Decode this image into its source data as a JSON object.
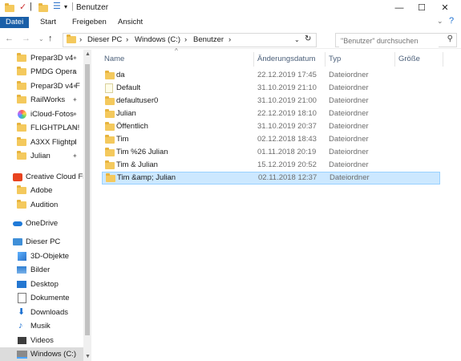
{
  "window": {
    "title": "Benutzer",
    "controls": {
      "minimize": "—",
      "maximize": "☐",
      "close": "✕"
    }
  },
  "ribbon": {
    "tabs": [
      {
        "label": "Datei",
        "active": true
      },
      {
        "label": "Start"
      },
      {
        "label": "Freigeben"
      },
      {
        "label": "Ansicht"
      }
    ]
  },
  "address": {
    "breadcrumbs": [
      "Dieser PC",
      "Windows (C:)",
      "Benutzer"
    ],
    "separator": "›"
  },
  "search": {
    "placeholder": "\"Benutzer\" durchsuchen"
  },
  "sidebar": {
    "items": [
      {
        "label": "Prepar3D v4",
        "icon": "folder-icon",
        "pinned": true
      },
      {
        "label": "PMDG Opera",
        "icon": "folder-icon",
        "pinned": true
      },
      {
        "label": "Prepar3D v4 F",
        "icon": "folder-icon",
        "pinned": true
      },
      {
        "label": "RailWorks",
        "icon": "folder-icon",
        "pinned": true
      },
      {
        "label": "iCloud-Fotos",
        "icon": "icloud-icon",
        "pinned": true
      },
      {
        "label": "FLIGHTPLAN!",
        "icon": "folder-icon",
        "pinned": true
      },
      {
        "label": "A3XX Flightpl",
        "icon": "folder-icon",
        "pinned": true
      },
      {
        "label": "Julian",
        "icon": "folder-icon",
        "pinned": true
      },
      {
        "label": "Creative Cloud Fil",
        "icon": "creative-cloud-icon"
      },
      {
        "label": "Adobe",
        "icon": "folder-icon"
      },
      {
        "label": "Audition",
        "icon": "folder-icon"
      },
      {
        "label": "OneDrive",
        "icon": "onedrive-icon"
      },
      {
        "label": "Dieser PC",
        "icon": "pc-icon"
      },
      {
        "label": "3D-Objekte",
        "icon": "3d-objects-icon"
      },
      {
        "label": "Bilder",
        "icon": "pictures-icon"
      },
      {
        "label": "Desktop",
        "icon": "desktop-icon"
      },
      {
        "label": "Dokumente",
        "icon": "documents-icon"
      },
      {
        "label": "Downloads",
        "icon": "downloads-icon"
      },
      {
        "label": "Musik",
        "icon": "music-icon"
      },
      {
        "label": "Videos",
        "icon": "videos-icon"
      },
      {
        "label": "Windows (C:)",
        "icon": "drive-icon",
        "selected": true
      }
    ]
  },
  "table": {
    "columns": [
      "Name",
      "Änderungsdatum",
      "Typ",
      "Größe"
    ],
    "rows": [
      {
        "name": "da",
        "date": "22.12.2019 17:45",
        "type": "Dateiordner"
      },
      {
        "name": "Default",
        "date": "31.10.2019 21:10",
        "type": "Dateiordner"
      },
      {
        "name": "defaultuser0",
        "date": "31.10.2019 21:00",
        "type": "Dateiordner"
      },
      {
        "name": "Julian",
        "date": "22.12.2019 18:10",
        "type": "Dateiordner"
      },
      {
        "name": "Öffentlich",
        "date": "31.10.2019 20:37",
        "type": "Dateiordner"
      },
      {
        "name": "Tim",
        "date": "02.12.2018 18:43",
        "type": "Dateiordner"
      },
      {
        "name": "Tim %26 Julian",
        "date": "01.11.2018 20:19",
        "type": "Dateiordner"
      },
      {
        "name": "Tim & Julian",
        "date": "15.12.2019 20:52",
        "type": "Dateiordner"
      },
      {
        "name": "Tim &amp; Julian",
        "date": "02.11.2018 12:37",
        "type": "Dateiordner",
        "selected": true
      }
    ]
  }
}
